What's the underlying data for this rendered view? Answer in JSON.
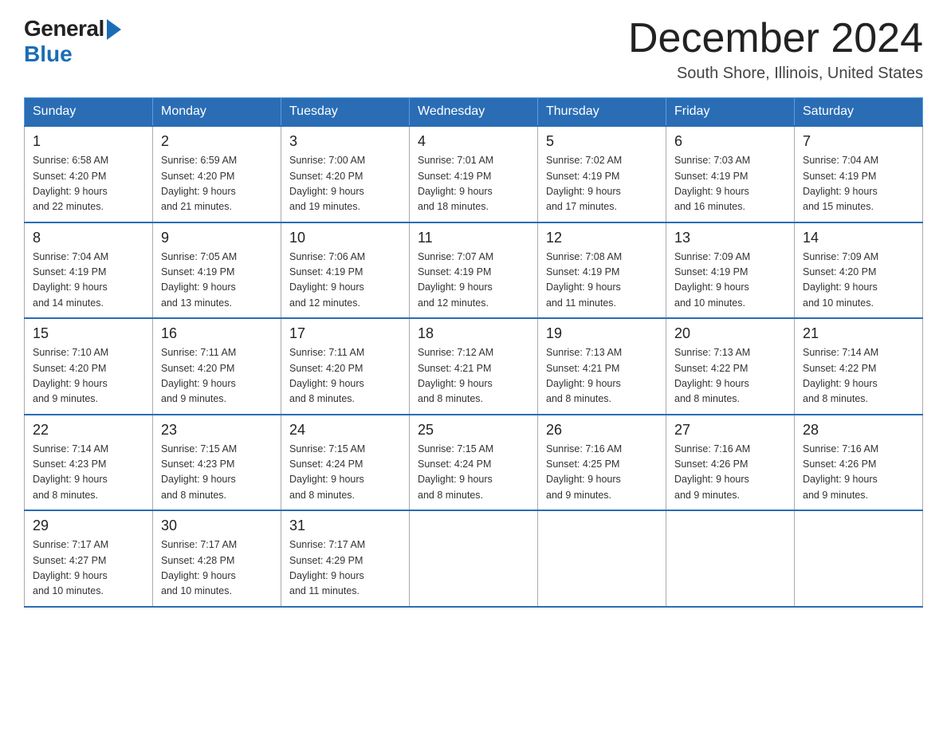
{
  "header": {
    "logo_general": "General",
    "logo_blue": "Blue",
    "title": "December 2024",
    "subtitle": "South Shore, Illinois, United States"
  },
  "columns": [
    "Sunday",
    "Monday",
    "Tuesday",
    "Wednesday",
    "Thursday",
    "Friday",
    "Saturday"
  ],
  "weeks": [
    [
      {
        "day": "1",
        "sunrise": "Sunrise: 6:58 AM",
        "sunset": "Sunset: 4:20 PM",
        "daylight": "Daylight: 9 hours",
        "daylight2": "and 22 minutes."
      },
      {
        "day": "2",
        "sunrise": "Sunrise: 6:59 AM",
        "sunset": "Sunset: 4:20 PM",
        "daylight": "Daylight: 9 hours",
        "daylight2": "and 21 minutes."
      },
      {
        "day": "3",
        "sunrise": "Sunrise: 7:00 AM",
        "sunset": "Sunset: 4:20 PM",
        "daylight": "Daylight: 9 hours",
        "daylight2": "and 19 minutes."
      },
      {
        "day": "4",
        "sunrise": "Sunrise: 7:01 AM",
        "sunset": "Sunset: 4:19 PM",
        "daylight": "Daylight: 9 hours",
        "daylight2": "and 18 minutes."
      },
      {
        "day": "5",
        "sunrise": "Sunrise: 7:02 AM",
        "sunset": "Sunset: 4:19 PM",
        "daylight": "Daylight: 9 hours",
        "daylight2": "and 17 minutes."
      },
      {
        "day": "6",
        "sunrise": "Sunrise: 7:03 AM",
        "sunset": "Sunset: 4:19 PM",
        "daylight": "Daylight: 9 hours",
        "daylight2": "and 16 minutes."
      },
      {
        "day": "7",
        "sunrise": "Sunrise: 7:04 AM",
        "sunset": "Sunset: 4:19 PM",
        "daylight": "Daylight: 9 hours",
        "daylight2": "and 15 minutes."
      }
    ],
    [
      {
        "day": "8",
        "sunrise": "Sunrise: 7:04 AM",
        "sunset": "Sunset: 4:19 PM",
        "daylight": "Daylight: 9 hours",
        "daylight2": "and 14 minutes."
      },
      {
        "day": "9",
        "sunrise": "Sunrise: 7:05 AM",
        "sunset": "Sunset: 4:19 PM",
        "daylight": "Daylight: 9 hours",
        "daylight2": "and 13 minutes."
      },
      {
        "day": "10",
        "sunrise": "Sunrise: 7:06 AM",
        "sunset": "Sunset: 4:19 PM",
        "daylight": "Daylight: 9 hours",
        "daylight2": "and 12 minutes."
      },
      {
        "day": "11",
        "sunrise": "Sunrise: 7:07 AM",
        "sunset": "Sunset: 4:19 PM",
        "daylight": "Daylight: 9 hours",
        "daylight2": "and 12 minutes."
      },
      {
        "day": "12",
        "sunrise": "Sunrise: 7:08 AM",
        "sunset": "Sunset: 4:19 PM",
        "daylight": "Daylight: 9 hours",
        "daylight2": "and 11 minutes."
      },
      {
        "day": "13",
        "sunrise": "Sunrise: 7:09 AM",
        "sunset": "Sunset: 4:19 PM",
        "daylight": "Daylight: 9 hours",
        "daylight2": "and 10 minutes."
      },
      {
        "day": "14",
        "sunrise": "Sunrise: 7:09 AM",
        "sunset": "Sunset: 4:20 PM",
        "daylight": "Daylight: 9 hours",
        "daylight2": "and 10 minutes."
      }
    ],
    [
      {
        "day": "15",
        "sunrise": "Sunrise: 7:10 AM",
        "sunset": "Sunset: 4:20 PM",
        "daylight": "Daylight: 9 hours",
        "daylight2": "and 9 minutes."
      },
      {
        "day": "16",
        "sunrise": "Sunrise: 7:11 AM",
        "sunset": "Sunset: 4:20 PM",
        "daylight": "Daylight: 9 hours",
        "daylight2": "and 9 minutes."
      },
      {
        "day": "17",
        "sunrise": "Sunrise: 7:11 AM",
        "sunset": "Sunset: 4:20 PM",
        "daylight": "Daylight: 9 hours",
        "daylight2": "and 8 minutes."
      },
      {
        "day": "18",
        "sunrise": "Sunrise: 7:12 AM",
        "sunset": "Sunset: 4:21 PM",
        "daylight": "Daylight: 9 hours",
        "daylight2": "and 8 minutes."
      },
      {
        "day": "19",
        "sunrise": "Sunrise: 7:13 AM",
        "sunset": "Sunset: 4:21 PM",
        "daylight": "Daylight: 9 hours",
        "daylight2": "and 8 minutes."
      },
      {
        "day": "20",
        "sunrise": "Sunrise: 7:13 AM",
        "sunset": "Sunset: 4:22 PM",
        "daylight": "Daylight: 9 hours",
        "daylight2": "and 8 minutes."
      },
      {
        "day": "21",
        "sunrise": "Sunrise: 7:14 AM",
        "sunset": "Sunset: 4:22 PM",
        "daylight": "Daylight: 9 hours",
        "daylight2": "and 8 minutes."
      }
    ],
    [
      {
        "day": "22",
        "sunrise": "Sunrise: 7:14 AM",
        "sunset": "Sunset: 4:23 PM",
        "daylight": "Daylight: 9 hours",
        "daylight2": "and 8 minutes."
      },
      {
        "day": "23",
        "sunrise": "Sunrise: 7:15 AM",
        "sunset": "Sunset: 4:23 PM",
        "daylight": "Daylight: 9 hours",
        "daylight2": "and 8 minutes."
      },
      {
        "day": "24",
        "sunrise": "Sunrise: 7:15 AM",
        "sunset": "Sunset: 4:24 PM",
        "daylight": "Daylight: 9 hours",
        "daylight2": "and 8 minutes."
      },
      {
        "day": "25",
        "sunrise": "Sunrise: 7:15 AM",
        "sunset": "Sunset: 4:24 PM",
        "daylight": "Daylight: 9 hours",
        "daylight2": "and 8 minutes."
      },
      {
        "day": "26",
        "sunrise": "Sunrise: 7:16 AM",
        "sunset": "Sunset: 4:25 PM",
        "daylight": "Daylight: 9 hours",
        "daylight2": "and 9 minutes."
      },
      {
        "day": "27",
        "sunrise": "Sunrise: 7:16 AM",
        "sunset": "Sunset: 4:26 PM",
        "daylight": "Daylight: 9 hours",
        "daylight2": "and 9 minutes."
      },
      {
        "day": "28",
        "sunrise": "Sunrise: 7:16 AM",
        "sunset": "Sunset: 4:26 PM",
        "daylight": "Daylight: 9 hours",
        "daylight2": "and 9 minutes."
      }
    ],
    [
      {
        "day": "29",
        "sunrise": "Sunrise: 7:17 AM",
        "sunset": "Sunset: 4:27 PM",
        "daylight": "Daylight: 9 hours",
        "daylight2": "and 10 minutes."
      },
      {
        "day": "30",
        "sunrise": "Sunrise: 7:17 AM",
        "sunset": "Sunset: 4:28 PM",
        "daylight": "Daylight: 9 hours",
        "daylight2": "and 10 minutes."
      },
      {
        "day": "31",
        "sunrise": "Sunrise: 7:17 AM",
        "sunset": "Sunset: 4:29 PM",
        "daylight": "Daylight: 9 hours",
        "daylight2": "and 11 minutes."
      },
      null,
      null,
      null,
      null
    ]
  ]
}
